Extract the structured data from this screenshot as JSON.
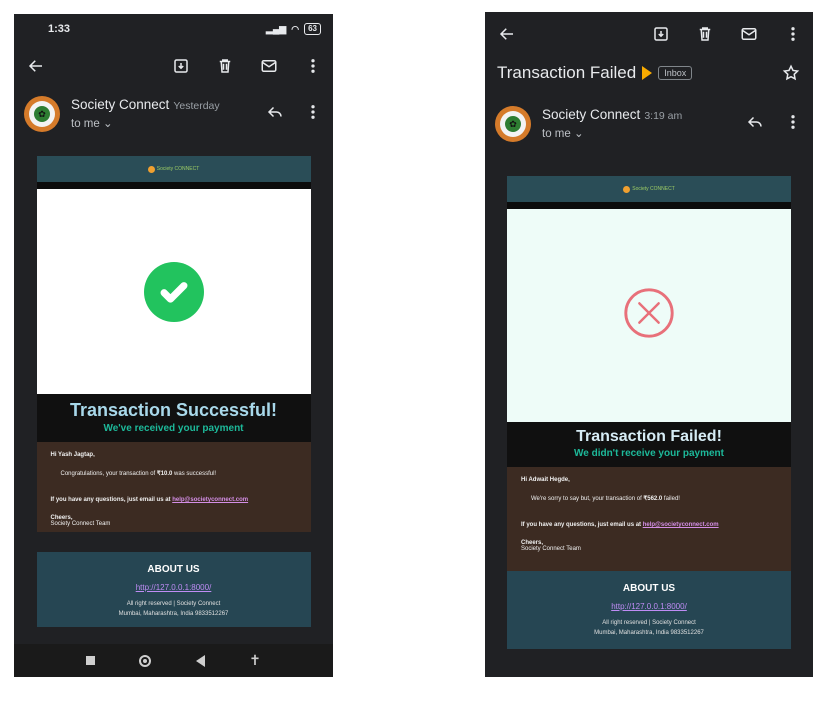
{
  "left_phone": {
    "status_bar": {
      "time": "1:33",
      "battery": "63"
    },
    "toolbar": {
      "icons": [
        "back-arrow-icon",
        "archive-icon",
        "delete-icon",
        "mark-unread-icon",
        "more-vert-icon"
      ]
    },
    "sender": {
      "name": "Society Connect",
      "time": "Yesterday",
      "to": "to me"
    },
    "email": {
      "header_logo": "Society CONNECT",
      "title": "Transaction Successful!",
      "subtitle": "We've received your payment",
      "greeting": "Hi Yash Jagtap,",
      "message_pre": "Congratulations, your transaction of ",
      "amount": "₹10.0",
      "message_post": " was successful!",
      "questions_text": "If you have any questions, just email us at",
      "email_link": "help@societyconnect.com",
      "cheers": "Cheers,",
      "team": "Society Connect Team",
      "about_title": "ABOUT US",
      "about_link": "http://127.0.0.1:8000/",
      "rights": "All right reserved | Society Connect",
      "address": "Mumbai, Maharashtra, India 9833512267"
    },
    "nav_bar": {
      "icons": [
        "recents-icon",
        "home-icon",
        "back-icon",
        "accessibility-icon"
      ]
    }
  },
  "right_phone": {
    "subject": "Transaction Failed",
    "label": "Inbox",
    "sender": {
      "name": "Society Connect",
      "time": "3:19 am",
      "to": "to me"
    },
    "email": {
      "header_logo": "Society CONNECT",
      "title": "Transaction Failed!",
      "subtitle": "We didn't receive your payment",
      "greeting": "Hi Adwait Hegde,",
      "message_pre": "We're sorry to say but, your transaction of ",
      "amount": "₹562.0",
      "message_post": " failed!",
      "questions_text": "If you have any questions, just email us at",
      "email_link": "help@societyconnect.com",
      "cheers": "Cheers,",
      "team": "Society Connect Team",
      "about_title": "ABOUT US",
      "about_link": "http://127.0.0.1:8000/",
      "rights": "All right reserved | Society Connect",
      "address": "Mumbai, Maharashtra, India 9833512267"
    }
  },
  "colors": {
    "success_green": "#22c35e",
    "fail_pink": "#e8707a",
    "important_marker": "#f9ab00",
    "subtitle_teal": "#1db99a"
  }
}
